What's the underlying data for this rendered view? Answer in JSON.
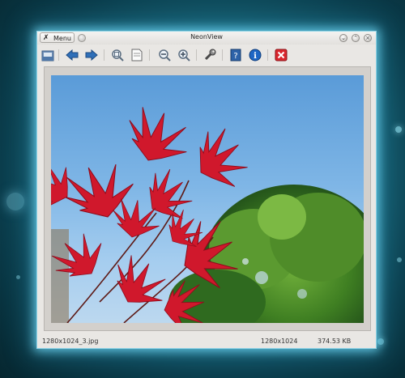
{
  "window": {
    "title": "NeonView",
    "menu_label": "Menu"
  },
  "toolbar": {
    "icons": [
      "open-folder-icon",
      "back-arrow-icon",
      "forward-arrow-icon",
      "zoom-fit-icon",
      "page-icon",
      "zoom-out-icon",
      "zoom-in-icon",
      "settings-wrench-icon",
      "help-book-icon",
      "info-icon",
      "close-red-icon"
    ]
  },
  "image": {
    "description_icon": "red-maple-leaves-photo"
  },
  "status": {
    "filename": "1280x1024_3.jpg",
    "dimensions": "1280x1024",
    "filesize": "374.53 KB"
  },
  "colors": {
    "glow": "#7fe1ff",
    "leaf_red": "#d0182c",
    "close_red": "#d9262d",
    "nav_blue": "#2f6fb8"
  }
}
